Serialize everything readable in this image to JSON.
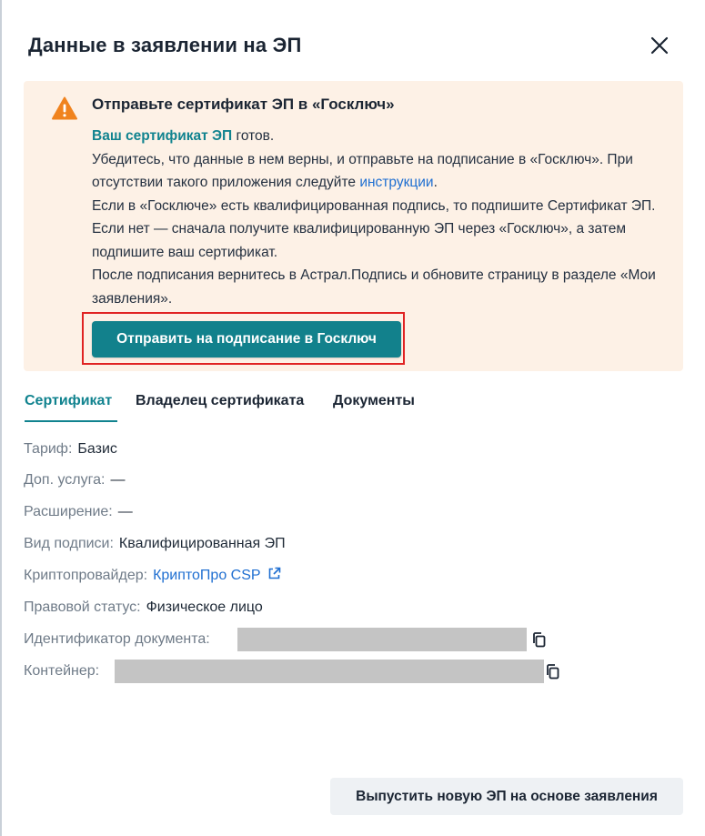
{
  "dialog": {
    "title": "Данные в заявлении на ЭП"
  },
  "alert": {
    "title": "Отправьте сертификат ЭП в «Госключ»",
    "line1_link": "Ваш сертификат ЭП",
    "line1_rest": " готов.",
    "para2_before": "Убедитесь, что данные в нем верны, и отправьте на подписание в «Госключ». При отсутствии такого приложения следуйте ",
    "para2_link": "инструкции",
    "para2_after": ".",
    "para3": "Если в «Госключе» есть квалифицированная подпись, то подпишите Сертификат ЭП. Если нет — сначала получите квалифицированную ЭП через «Госключ», а затем подпишите ваш сертификат.",
    "para4": "После подписания вернитесь в Астрал.Подпись и обновите страницу в разделе «Мои заявления».",
    "button_label": "Отправить на подписание в Госключ"
  },
  "tabs": [
    {
      "label": "Сертификат",
      "active": true
    },
    {
      "label": "Владелец сертификата",
      "active": false
    },
    {
      "label": "Документы",
      "active": false
    }
  ],
  "fields": {
    "tariff": {
      "label": "Тариф:",
      "value": "Базис"
    },
    "extra_service": {
      "label": "Доп. услуга:",
      "value": "—"
    },
    "extension": {
      "label": "Расширение:",
      "value": "—"
    },
    "signature_type": {
      "label": "Вид подписи:",
      "value": "Квалифицированная ЭП"
    },
    "crypto_provider": {
      "label": "Криптопровайдер:",
      "value": "КриптоПро CSP"
    },
    "legal_status": {
      "label": "Правовой статус:",
      "value": "Физическое лицо"
    },
    "document_id": {
      "label": "Идентификатор документа:"
    },
    "container": {
      "label": "Контейнер:"
    }
  },
  "footer": {
    "issue_button_label": "Выпустить новую ЭП на основе заявления"
  },
  "icons": {
    "close": "close-icon",
    "warning": "warning-icon",
    "external_link": "external-link-icon",
    "copy": "copy-icon"
  },
  "colors": {
    "accent": "#11838f",
    "link": "#1f6fd1",
    "alert_background": "#fdf1e6",
    "warning": "#f0831e",
    "highlight": "#e02323"
  }
}
